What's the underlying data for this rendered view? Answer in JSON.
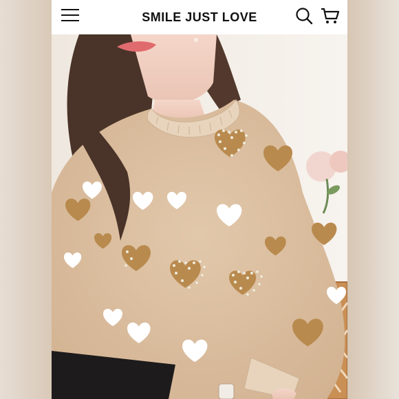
{
  "header": {
    "brand": "SMILE JUST LOVE",
    "menu_icon": "hamburger-menu-icon",
    "search_icon": "search-icon",
    "cart_icon": "cart-icon"
  },
  "product_image": {
    "subject": "woman-wearing-beige-heart-pattern-sweater"
  },
  "colors": {
    "sweater": "#dcc0a0",
    "heart_white": "#ffffff",
    "heart_camel": "#b98a4e",
    "pearl": "#f4efe2",
    "hair": "#4a3328",
    "lip": "#e06b6e"
  }
}
